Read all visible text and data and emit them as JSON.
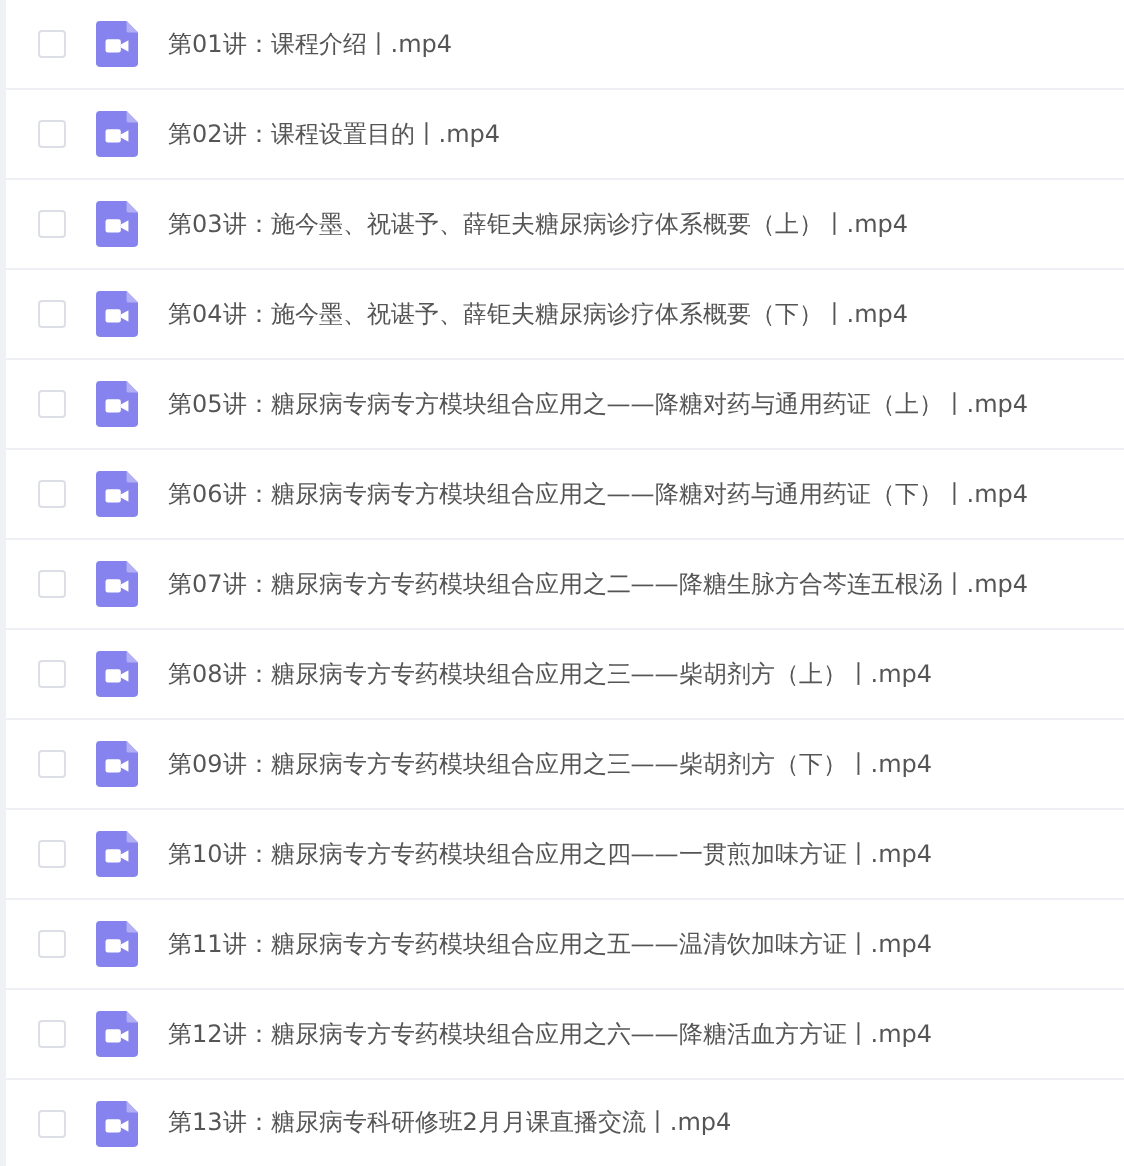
{
  "files": [
    {
      "name": "第01讲：课程介绍丨.mp4",
      "checked": false
    },
    {
      "name": "第02讲：课程设置目的丨.mp4",
      "checked": false
    },
    {
      "name": "第03讲：施今墨、祝谌予、薛钜夫糖尿病诊疗体系概要（上）丨.mp4",
      "checked": false
    },
    {
      "name": "第04讲：施今墨、祝谌予、薛钜夫糖尿病诊疗体系概要（下）丨.mp4",
      "checked": false
    },
    {
      "name": "第05讲：糖尿病专病专方模块组合应用之——降糖对药与通用药证（上）丨.mp4",
      "checked": false
    },
    {
      "name": "第06讲：糖尿病专病专方模块组合应用之——降糖对药与通用药证（下）丨.mp4",
      "checked": false
    },
    {
      "name": "第07讲：糖尿病专方专药模块组合应用之二——降糖生脉方合芩连五根汤丨.mp4",
      "checked": false
    },
    {
      "name": "第08讲：糖尿病专方专药模块组合应用之三——柴胡剂方（上）丨.mp4",
      "checked": false
    },
    {
      "name": "第09讲：糖尿病专方专药模块组合应用之三——柴胡剂方（下）丨.mp4",
      "checked": false
    },
    {
      "name": "第10讲：糖尿病专方专药模块组合应用之四——一贯煎加味方证丨.mp4",
      "checked": false
    },
    {
      "name": "第11讲：糖尿病专方专药模块组合应用之五——温清饮加味方证丨.mp4",
      "checked": false
    },
    {
      "name": "第12讲：糖尿病专方专药模块组合应用之六——降糖活血方方证丨.mp4",
      "checked": false
    },
    {
      "name": "第13讲：糖尿病专科研修班2月月课直播交流丨.mp4",
      "checked": false
    }
  ]
}
